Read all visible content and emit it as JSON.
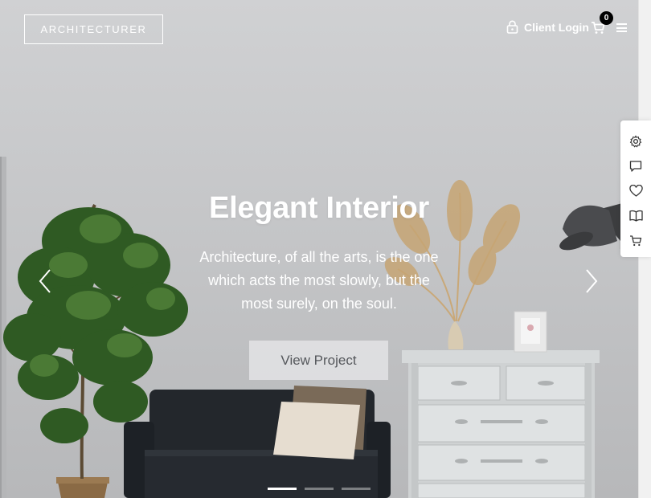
{
  "header": {
    "logo_text": "ARCHITECTURER",
    "client_login_label": "Client Login",
    "cart_count": "0",
    "icons": {
      "lock": "lock-icon",
      "cart": "cart-icon",
      "menu": "hamburger-menu-icon"
    }
  },
  "side_toolbar": {
    "items": [
      {
        "icon": "settings-icon"
      },
      {
        "icon": "comment-icon"
      },
      {
        "icon": "heart-icon"
      },
      {
        "icon": "book-icon"
      },
      {
        "icon": "cart-icon"
      }
    ]
  },
  "hero": {
    "title": "Elegant Interior",
    "subtitle": "Architecture, of all the arts, is the one which acts the most slowly, but the most surely, on the soul.",
    "cta_label": "View Project",
    "slides": {
      "count": 3,
      "active_index": 0
    }
  },
  "colors": {
    "wall": "#c9cacc",
    "text": "#ffffff",
    "button_bg": "#e4e4e6",
    "button_text": "#55585c"
  }
}
